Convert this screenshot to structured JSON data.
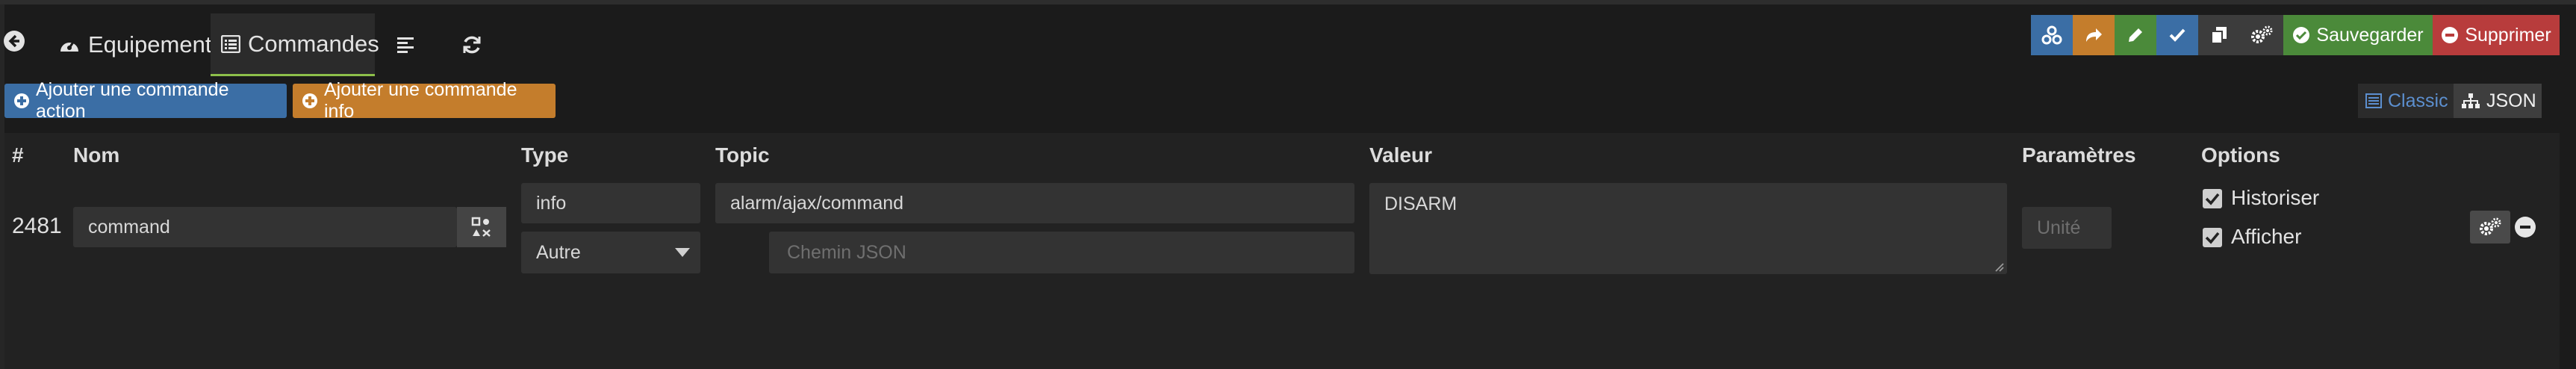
{
  "nav": {
    "back_icon": "arrow-circle-left-icon",
    "tabs": [
      {
        "label": "Equipement",
        "icon": "tachometer-icon",
        "active": false
      },
      {
        "label": "Commandes",
        "icon": "list-alt-icon",
        "active": true
      },
      {
        "label": "",
        "icon": "align-left-icon",
        "active": false
      },
      {
        "label": "",
        "icon": "refresh-icon",
        "active": false
      }
    ]
  },
  "toolbar": {
    "save_label": "Sauvegarder",
    "delete_label": "Supprimer",
    "icon_buttons": [
      {
        "icon": "cogs-cluster-icon",
        "color": "#3b6ea5"
      },
      {
        "icon": "share-icon",
        "color": "#c47d2c"
      },
      {
        "icon": "pencil-icon",
        "color": "#4b8a3a"
      },
      {
        "icon": "check-icon",
        "color": "#3b6ea5"
      },
      {
        "icon": "copy-icon",
        "color": "#3c3c3c"
      },
      {
        "icon": "cogs-icon",
        "color": "#3c3c3c"
      }
    ],
    "save_color": "#4b8a3a",
    "delete_color": "#b83c3c"
  },
  "actions": {
    "add_action_label": "Ajouter une commande action",
    "add_info_label": "Ajouter une commande info",
    "add_action_color": "#3b6ea5",
    "add_info_color": "#c47d2c"
  },
  "view_mode": {
    "classic_label": "Classic",
    "json_label": "JSON",
    "active": "JSON"
  },
  "table": {
    "headers": {
      "id": "#",
      "name": "Nom",
      "type": "Type",
      "topic": "Topic",
      "value": "Valeur",
      "params": "Paramètres",
      "options": "Options"
    },
    "row": {
      "id": "2481",
      "name": "command",
      "type": "info",
      "subtype": "Autre",
      "topic": "alarm/ajax/command",
      "json_path_placeholder": "Chemin JSON",
      "value": "DISARM",
      "unit_placeholder": "Unité",
      "options": [
        {
          "label": "Historiser",
          "checked": true
        },
        {
          "label": "Afficher",
          "checked": true
        }
      ]
    }
  }
}
